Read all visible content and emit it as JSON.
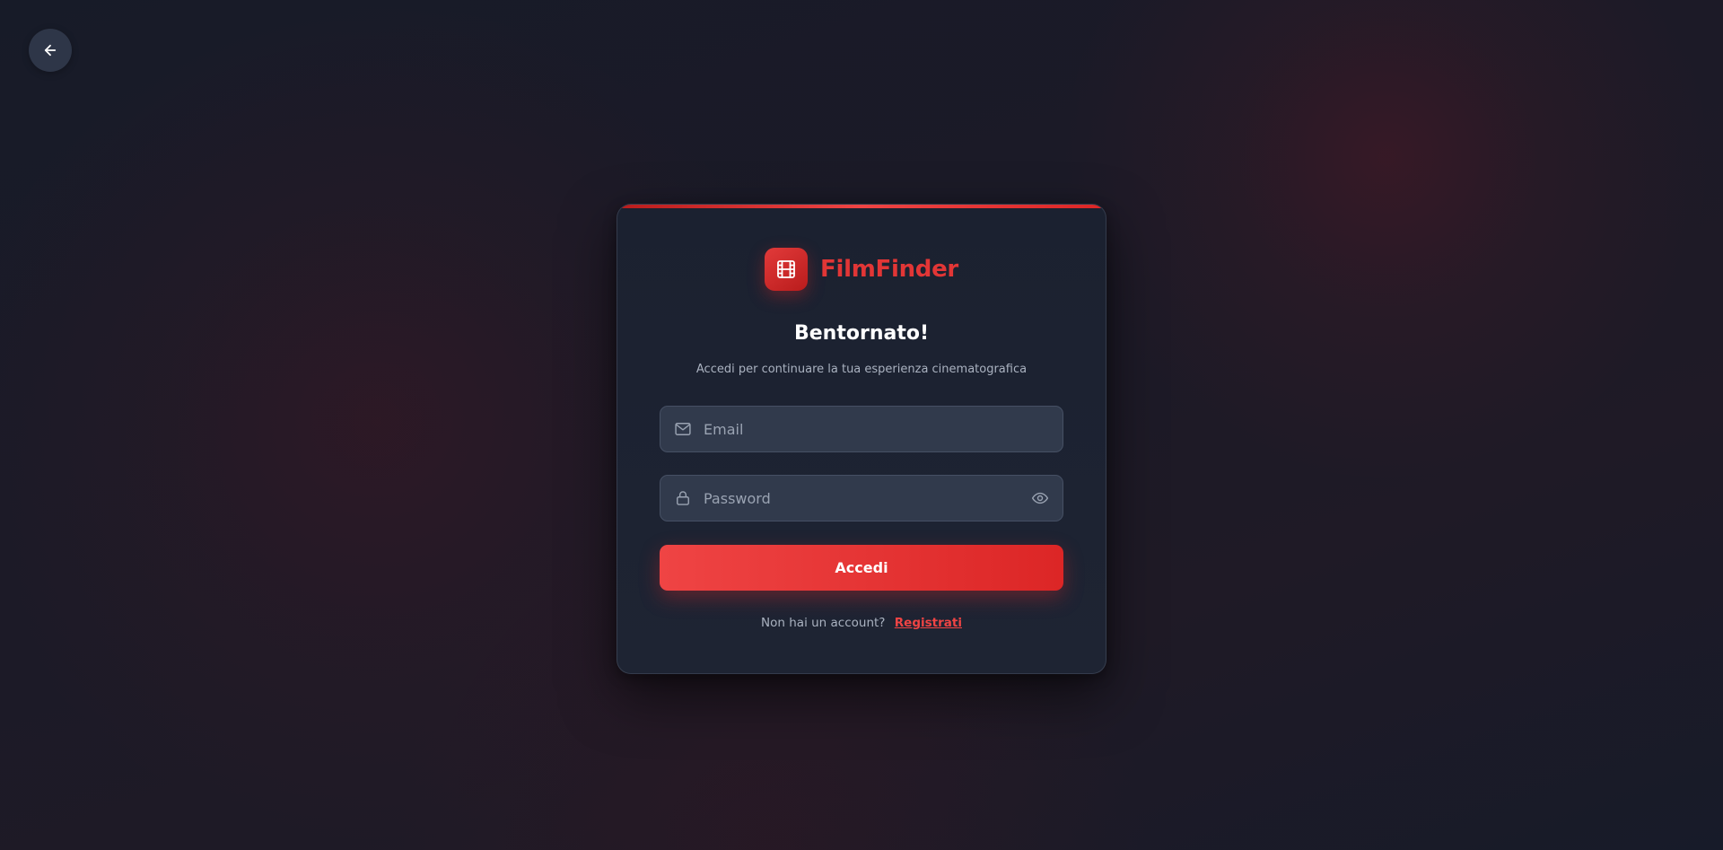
{
  "back": {
    "icon": "arrow-left-icon",
    "accent": "#2e3648"
  },
  "brand": {
    "name": "FilmFinder",
    "logo_icon": "film-icon",
    "color": "#e23636"
  },
  "login": {
    "title": "Bentornato!",
    "subtitle": "Accedi per continuare la tua esperienza cinematografica",
    "email": {
      "value": "",
      "placeholder": "Email",
      "icon": "mail-icon"
    },
    "password": {
      "value": "",
      "placeholder": "Password",
      "icon": "lock-icon",
      "toggle_icon": "eye-icon"
    },
    "submit_label": "Accedi",
    "signup_prompt": "Non hai un account?",
    "signup_link": "Registrati"
  },
  "colors": {
    "accent": "#ef4444",
    "accent_dark": "#dc2626",
    "card": "#1b2130",
    "field": "#313a4c"
  }
}
